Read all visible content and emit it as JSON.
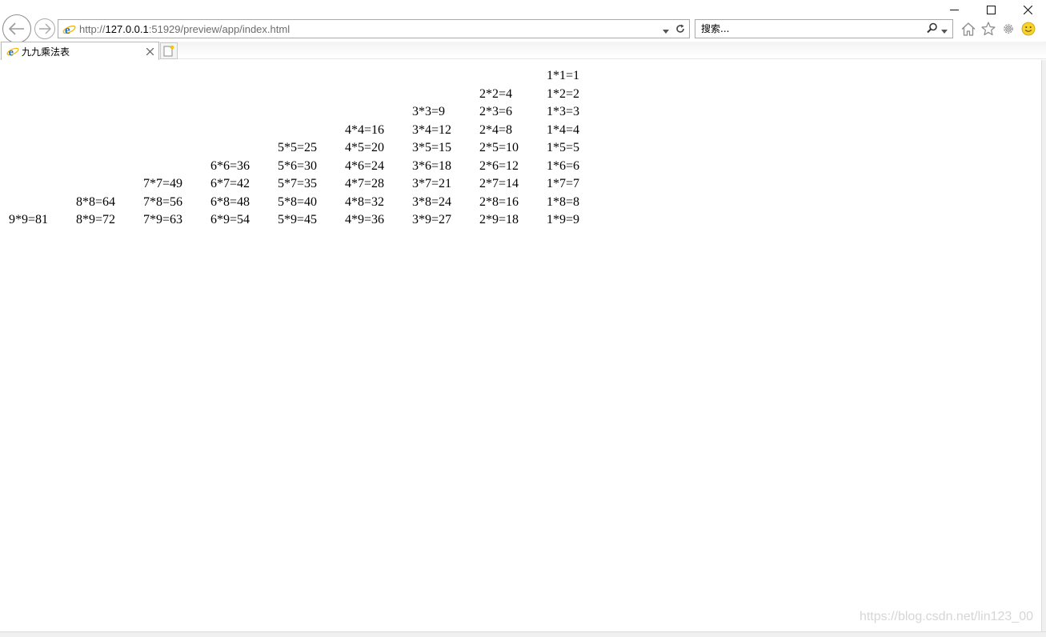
{
  "browser": {
    "address": {
      "scheme": "http://",
      "host": "127.0.0.1",
      "rest": ":51929/preview/app/index.html"
    },
    "search": {
      "placeholder": "搜索..."
    },
    "tab": {
      "title": "九九乘法表"
    }
  },
  "table": {
    "rows": [
      [
        "",
        "",
        "",
        "",
        "",
        "",
        "",
        "",
        "1*1=1"
      ],
      [
        "",
        "",
        "",
        "",
        "",
        "",
        "",
        "2*2=4",
        "1*2=2"
      ],
      [
        "",
        "",
        "",
        "",
        "",
        "",
        "3*3=9",
        "2*3=6",
        "1*3=3"
      ],
      [
        "",
        "",
        "",
        "",
        "",
        "4*4=16",
        "3*4=12",
        "2*4=8",
        "1*4=4"
      ],
      [
        "",
        "",
        "",
        "",
        "5*5=25",
        "4*5=20",
        "3*5=15",
        "2*5=10",
        "1*5=5"
      ],
      [
        "",
        "",
        "",
        "6*6=36",
        "5*6=30",
        "4*6=24",
        "3*6=18",
        "2*6=12",
        "1*6=6"
      ],
      [
        "",
        "",
        "7*7=49",
        "6*7=42",
        "5*7=35",
        "4*7=28",
        "3*7=21",
        "2*7=14",
        "1*7=7"
      ],
      [
        "",
        "8*8=64",
        "7*8=56",
        "6*8=48",
        "5*8=40",
        "4*8=32",
        "3*8=24",
        "2*8=16",
        "1*8=8"
      ],
      [
        "9*9=81",
        "8*9=72",
        "7*9=63",
        "6*9=54",
        "5*9=45",
        "4*9=36",
        "3*9=27",
        "2*9=18",
        "1*9=9"
      ]
    ]
  },
  "watermark": "https://blog.csdn.net/lin123_00",
  "icons": {
    "back": "back-arrow-icon",
    "forward": "forward-arrow-icon",
    "ie": "ie-logo-icon",
    "refresh": "refresh-icon",
    "dropdown": "chevron-down-icon",
    "search": "search-icon",
    "home": "home-icon",
    "favorites": "star-icon",
    "tools": "gear-icon",
    "feedback": "smiley-icon",
    "close": "close-icon",
    "new_tab": "new-tab-icon"
  },
  "colors": {
    "ie_blue": "#1e6fc7",
    "ie_ring": "#f2b600"
  }
}
